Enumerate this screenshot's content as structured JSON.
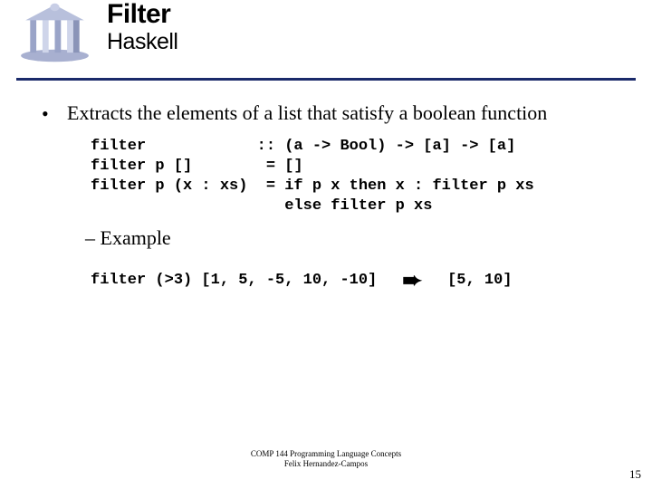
{
  "header": {
    "title": "Filter",
    "subtitle": "Haskell"
  },
  "body": {
    "bullet": "Extracts the elements of a list that satisfy a boolean function",
    "code_lines": [
      "filter            :: (a -> Bool) -> [a] -> [a]",
      "filter p []        = []",
      "filter p (x : xs)  = if p x then x : filter p xs",
      "                     else filter p xs"
    ],
    "sub_bullet": "– Example",
    "example_input": "filter (>3) [1, 5, -5, 10, -10]",
    "example_arrow": "➨",
    "example_output": "[5, 10]"
  },
  "footer": {
    "line1": "COMP 144 Programming Language Concepts",
    "line2": "Felix Hernandez-Campos"
  },
  "pagenum": "15"
}
